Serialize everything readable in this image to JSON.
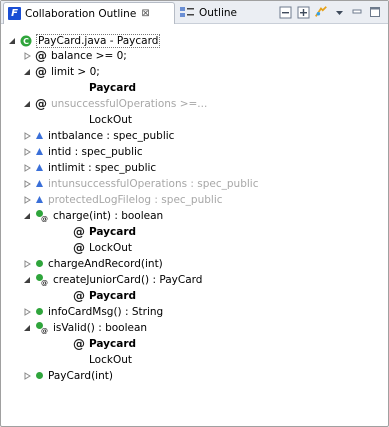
{
  "tabs": {
    "active": {
      "title": "Collaboration Outline",
      "close": "⊠"
    },
    "inactive": {
      "title": "Outline"
    }
  },
  "tree": {
    "root": {
      "label": "PayCard.java - Paycard"
    },
    "rows": [
      {
        "id": "balance",
        "label": "balance >= 0;"
      },
      {
        "id": "limit",
        "label": "limit > 0;"
      },
      {
        "id": "limit_role",
        "label": "Paycard"
      },
      {
        "id": "unsucc",
        "label": "unsuccessfulOperations >=..."
      },
      {
        "id": "unsucc_role",
        "label": "LockOut"
      },
      {
        "id": "intbalance",
        "label": "intbalance : spec_public"
      },
      {
        "id": "intid",
        "label": "intid : spec_public"
      },
      {
        "id": "intlimit",
        "label": "intlimit : spec_public"
      },
      {
        "id": "intunsucc",
        "label": "intunsuccessfulOperations : spec_public"
      },
      {
        "id": "protected",
        "label": "protectedLogFilelog : spec_public"
      },
      {
        "id": "charge",
        "label": "charge(int) : boolean"
      },
      {
        "id": "charge_r1",
        "label": "Paycard"
      },
      {
        "id": "charge_r2",
        "label": "LockOut"
      },
      {
        "id": "chargeAndRecord",
        "label": "chargeAndRecord(int)"
      },
      {
        "id": "createJunior",
        "label": "createJuniorCard() : PayCard"
      },
      {
        "id": "createJunior_r1",
        "label": "Paycard"
      },
      {
        "id": "infoCardMsg",
        "label": "infoCardMsg() : String"
      },
      {
        "id": "isValid",
        "label": "isValid() : boolean"
      },
      {
        "id": "isValid_r1",
        "label": "Paycard"
      },
      {
        "id": "isValid_r2",
        "label": "LockOut"
      },
      {
        "id": "payCard",
        "label": "PayCard(int)"
      }
    ]
  },
  "glyphs": {
    "at": "@"
  },
  "colors": {
    "accent": "#1a4ed4",
    "field": "#3a6fd8",
    "method": "#2fa53c",
    "gray": "#a7a7a7"
  }
}
